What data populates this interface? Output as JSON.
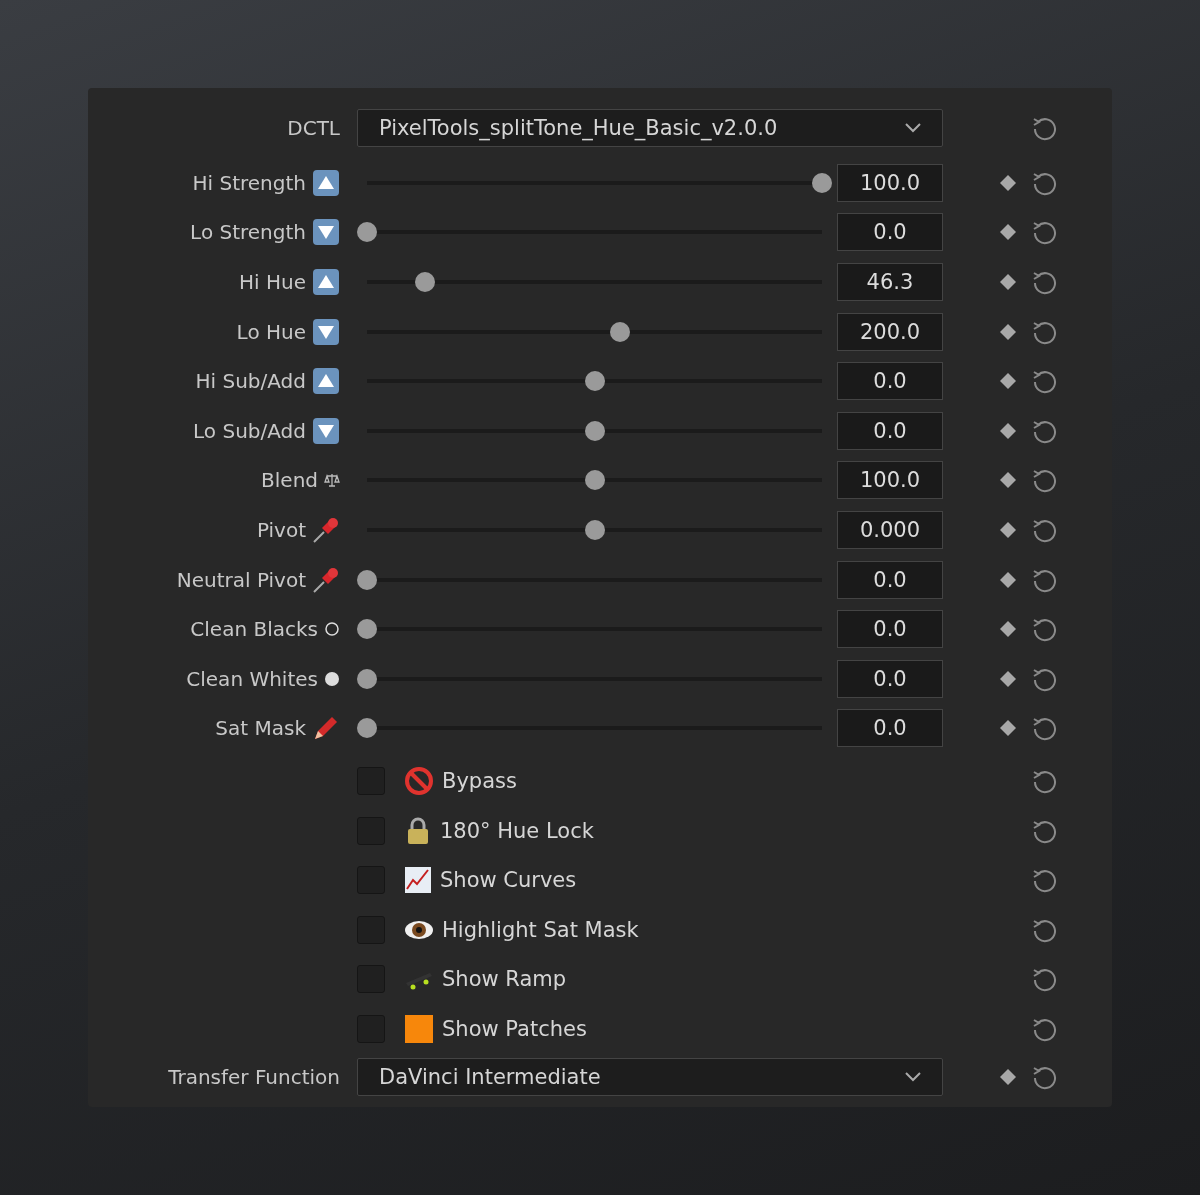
{
  "dctl": {
    "label": "DCTL",
    "value": "PixelTools_splitTone_Hue_Basic_v2.0.0"
  },
  "sliders": [
    {
      "label": "Hi Strength",
      "kind": "up",
      "level": 1.0,
      "reading": "100.0"
    },
    {
      "label": "Lo Strength",
      "kind": "down",
      "level": 0,
      "reading": "0.0"
    },
    {
      "label": "Hi Hue",
      "kind": "up",
      "level": 0.128,
      "reading": "46.3"
    },
    {
      "label": "Lo Hue",
      "kind": "down",
      "level": 0.555,
      "reading": "200.0"
    },
    {
      "label": "Hi Sub/Add",
      "kind": "up",
      "level": 0.5,
      "reading": "0.0"
    },
    {
      "label": "Lo Sub/Add",
      "kind": "down",
      "level": 0.5,
      "reading": "0.0"
    },
    {
      "label": "Blend",
      "kind": "scale",
      "level": 0.5,
      "reading": "100.0"
    },
    {
      "label": "Pivot",
      "kind": "pin",
      "level": 0.5,
      "reading": "0.000"
    },
    {
      "label": "Neutral Pivot",
      "kind": "pin",
      "level": 0,
      "reading": "0.0"
    },
    {
      "label": "Clean Blacks",
      "kind": "ring",
      "level": 0,
      "reading": "0.0"
    },
    {
      "label": "Clean Whites",
      "kind": "dot",
      "level": 0,
      "reading": "0.0"
    },
    {
      "label": "Sat Mask",
      "kind": "crayon",
      "level": 0,
      "reading": "0.0"
    }
  ],
  "checkboxes": [
    {
      "label": "Bypass",
      "kind": "forbidden",
      "checked": false
    },
    {
      "label": "180° Hue Lock",
      "kind": "lock",
      "checked": false
    },
    {
      "label": "Show Curves",
      "kind": "chart",
      "checked": false
    },
    {
      "label": "Highlight Sat Mask",
      "kind": "eye",
      "checked": false
    },
    {
      "label": "Show Ramp",
      "kind": "skateboard",
      "checked": false
    },
    {
      "label": "Show Patches",
      "kind": "square",
      "checked": false
    }
  ],
  "transfer": {
    "label": "Transfer Function",
    "value": "DaVinci Intermediate"
  }
}
